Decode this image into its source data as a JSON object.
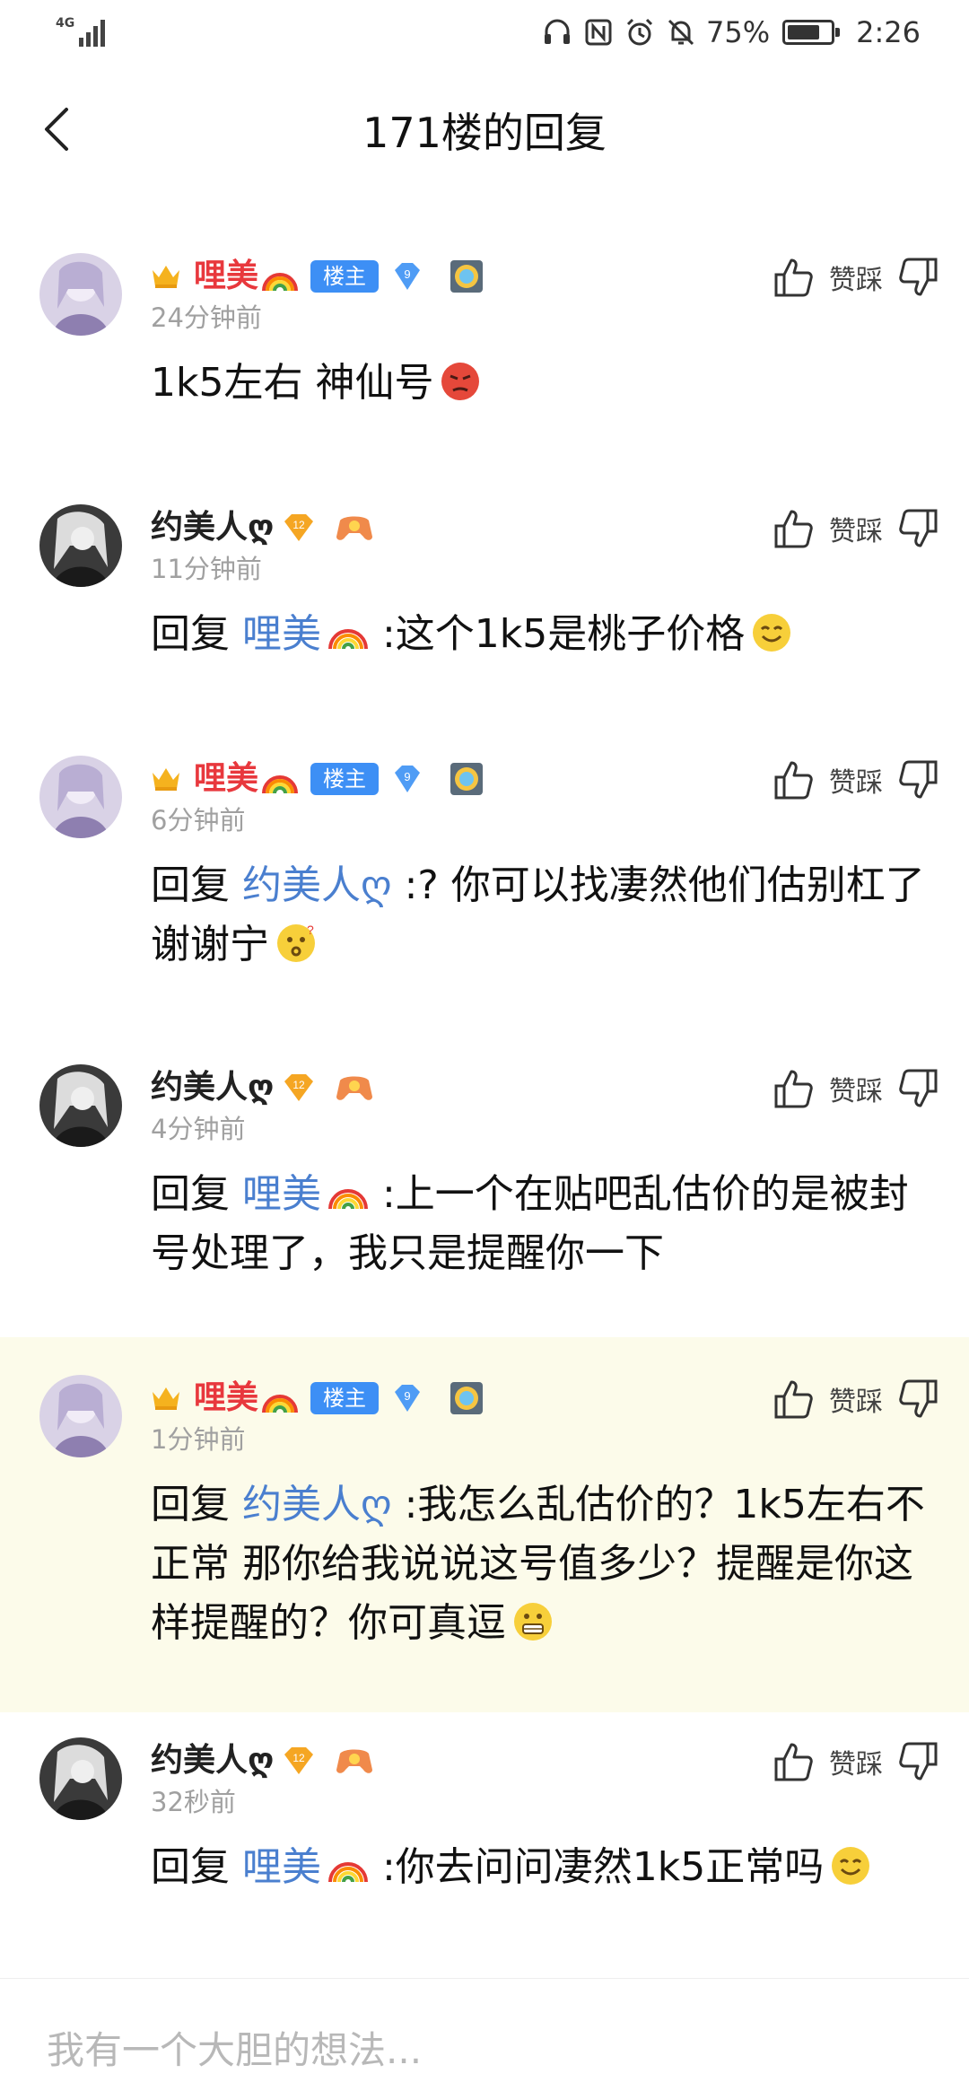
{
  "status_bar": {
    "network": "4G",
    "battery_percent_label": "75%",
    "battery_level": 0.75,
    "time": "2:26"
  },
  "header": {
    "title": "171楼的回复"
  },
  "vote_label": "赞踩",
  "comments": [
    {
      "user": "哩美",
      "owner_badge": "楼主",
      "level": "9",
      "time": "24分钟前",
      "text": "1k5左右 神仙号"
    },
    {
      "user": "约美人ღ",
      "level": "12",
      "time": "11分钟前",
      "prefix": "回复 ",
      "mention": "哩美",
      "text": " :这个1k5是桃子价格"
    },
    {
      "user": "哩美",
      "owner_badge": "楼主",
      "level": "9",
      "time": "6分钟前",
      "prefix": "回复 ",
      "mention": "约美人ღ",
      "text": " :? 你可以找凄然他们估别杠了谢谢宁"
    },
    {
      "user": "约美人ღ",
      "level": "12",
      "time": "4分钟前",
      "prefix": "回复 ",
      "mention": "哩美",
      "text": " :上一个在贴吧乱估价的是被封号处理了，我只是提醒你一下"
    },
    {
      "user": "哩美",
      "owner_badge": "楼主",
      "level": "9",
      "time": "1分钟前",
      "prefix": "回复 ",
      "mention": "约美人ღ",
      "text": " :我怎么乱估价的？1k5左右不正常 那你给我说说这号值多少？提醒是你这样提醒的？你可真逗"
    },
    {
      "user": "约美人ღ",
      "level": "12",
      "time": "32秒前",
      "prefix": "回复 ",
      "mention": "哩美",
      "text": " :你去问问凄然1k5正常吗"
    }
  ],
  "input": {
    "placeholder": "我有一个大胆的想法..."
  },
  "colors": {
    "poster_name": "#e8383d",
    "mention": "#4a7fcf",
    "owner_badge": "#3d8ff5",
    "highlight_bg": "#fcfbea"
  },
  "icons": [
    "back-icon",
    "thumbs-up-icon",
    "thumbs-down-icon",
    "crown-icon",
    "rainbow-icon",
    "diamond-level-icon",
    "gamepad-badge-icon",
    "emblem-badge-icon"
  ]
}
